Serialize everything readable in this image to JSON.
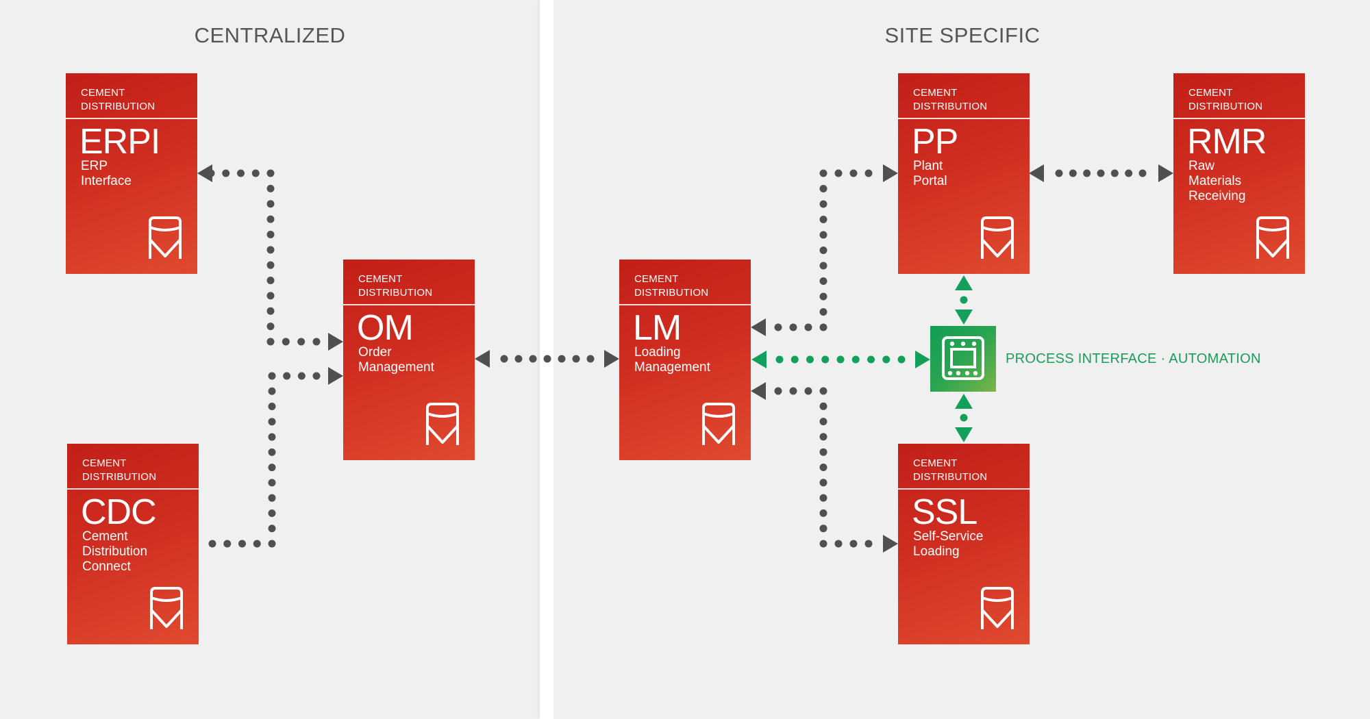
{
  "sections": {
    "left_title": "CENTRALIZED",
    "right_title": "SITE SPECIFIC"
  },
  "boxes": {
    "erpi": {
      "header_line1": "CEMENT",
      "header_line2": "DISTRIBUTION",
      "acronym": "ERPI",
      "subtitle": [
        "ERP",
        "Interface"
      ],
      "icon": "silo-icon"
    },
    "cdc": {
      "header_line1": "CEMENT",
      "header_line2": "DISTRIBUTION",
      "acronym": "CDC",
      "subtitle": [
        "Cement",
        "Distribution",
        "Connect"
      ],
      "icon": "silo-icon"
    },
    "om": {
      "header_line1": "CEMENT",
      "header_line2": "DISTRIBUTION",
      "acronym": "OM",
      "subtitle": [
        "Order",
        "Management"
      ],
      "icon": "silo-icon"
    },
    "lm": {
      "header_line1": "CEMENT",
      "header_line2": "DISTRIBUTION",
      "acronym": "LM",
      "subtitle": [
        "Loading",
        "Management"
      ],
      "icon": "silo-icon"
    },
    "pp": {
      "header_line1": "CEMENT",
      "header_line2": "DISTRIBUTION",
      "acronym": "PP",
      "subtitle": [
        "Plant",
        "Portal"
      ],
      "icon": "silo-icon"
    },
    "rmr": {
      "header_line1": "CEMENT",
      "header_line2": "DISTRIBUTION",
      "acronym": "RMR",
      "subtitle": [
        "Raw",
        "Materials",
        "Receiving"
      ],
      "icon": "silo-icon"
    },
    "ssl": {
      "header_line1": "CEMENT",
      "header_line2": "DISTRIBUTION",
      "acronym": "SSL",
      "subtitle": [
        "Self-Service",
        "Loading"
      ],
      "icon": "silo-icon"
    }
  },
  "process_interface": {
    "label": "PROCESS INTERFACE · AUTOMATION",
    "icon": "controller-chip-icon"
  },
  "connections": [
    {
      "from": "om",
      "to": "erpi",
      "style": "dotted",
      "color": "#505050"
    },
    {
      "from": "cdc",
      "to": "om",
      "style": "dotted",
      "color": "#505050"
    },
    {
      "from": "om",
      "to": "lm",
      "style": "dotted",
      "bidirectional": true,
      "color": "#505050"
    },
    {
      "from": "lm",
      "to": "pp",
      "style": "dotted",
      "bidirectional": true,
      "color": "#505050"
    },
    {
      "from": "pp",
      "to": "rmr",
      "style": "dotted",
      "bidirectional": true,
      "color": "#505050"
    },
    {
      "from": "lm",
      "to": "ssl",
      "style": "dotted",
      "bidirectional": true,
      "color": "#505050"
    },
    {
      "from": "process_interface",
      "to": "lm",
      "style": "dotted",
      "bidirectional": true,
      "color": "#13a05a"
    },
    {
      "from": "process_interface",
      "to": "pp",
      "style": "dotted",
      "bidirectional": true,
      "color": "#13a05a"
    },
    {
      "from": "process_interface",
      "to": "ssl",
      "style": "dotted",
      "bidirectional": true,
      "color": "#13a05a"
    }
  ],
  "colors": {
    "box_red_start": "#c21f18",
    "box_red_end": "#e04a30",
    "connector_gray": "#505050",
    "automation_green": "#13a05a"
  }
}
